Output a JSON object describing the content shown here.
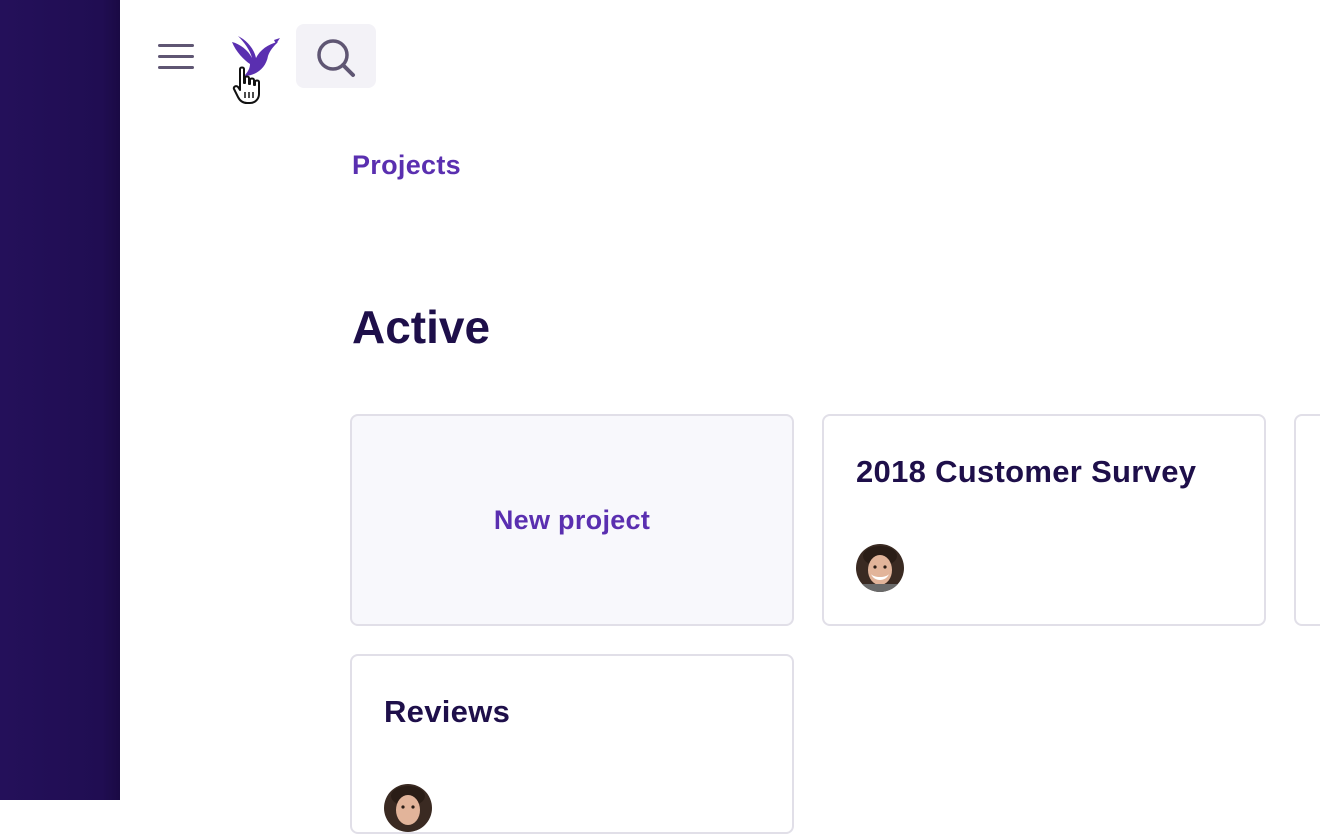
{
  "app": {
    "brand_color": "#5a2fb0",
    "rail_color": "#200d52",
    "menu_icon": "hamburger-menu-icon",
    "logo_icon": "bird-logo-icon",
    "search_icon": "search-icon"
  },
  "breadcrumb": {
    "label": "Projects"
  },
  "section": {
    "title": "Active"
  },
  "cards": {
    "new_project": {
      "label": "New project"
    },
    "projects": [
      {
        "title": "2018 Customer Survey",
        "avatar": "user-avatar"
      },
      {
        "title": "Reviews",
        "avatar": "user-avatar"
      }
    ]
  }
}
